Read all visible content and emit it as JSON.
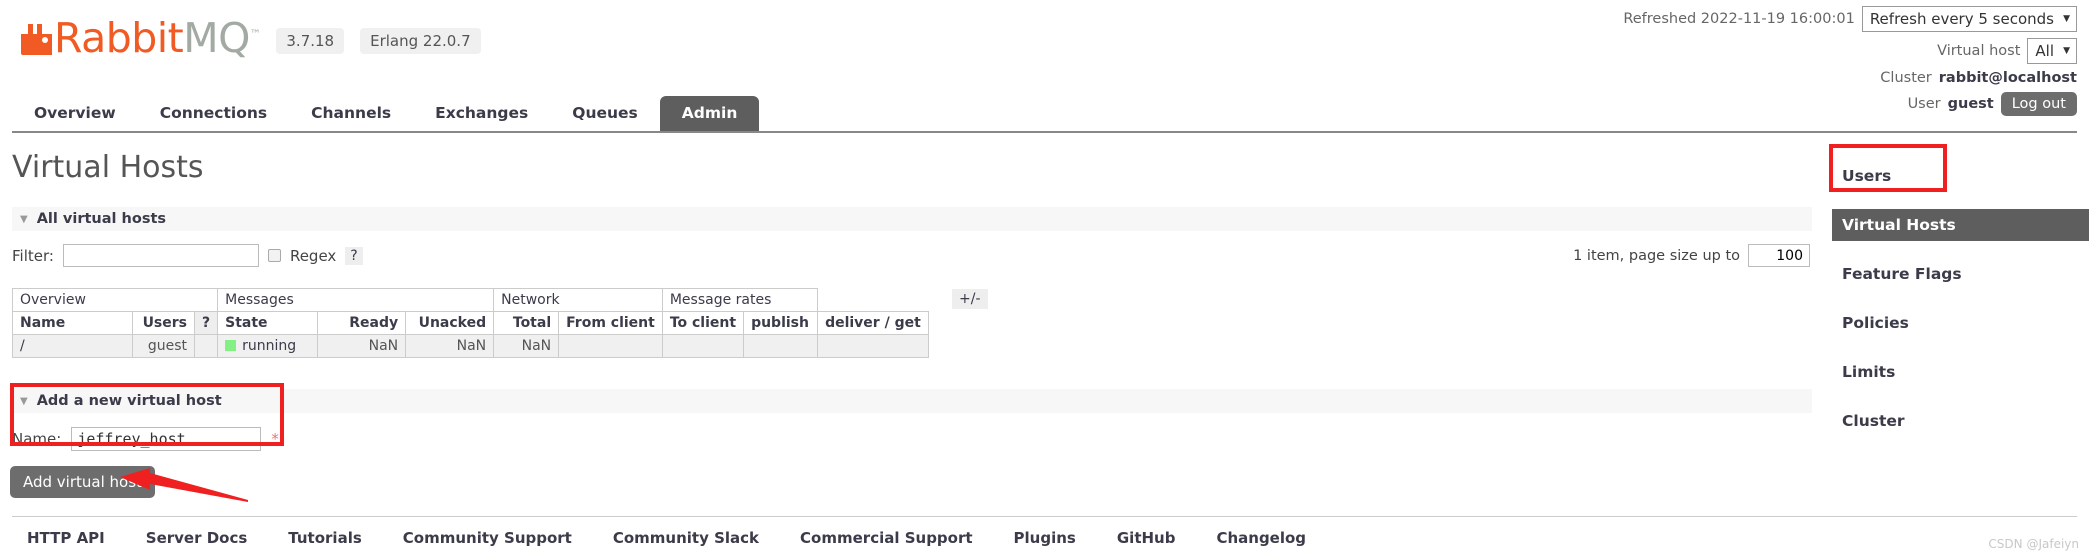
{
  "brand": {
    "name_part1": "Rabbit",
    "name_part2": "MQ",
    "trademark": "™",
    "version": "3.7.18",
    "erlang": "Erlang 22.0.7",
    "accent_color": "#f15a22",
    "muted_color": "#a2aaa3"
  },
  "topbar": {
    "refreshed": "Refreshed 2022-11-19 16:00:01",
    "refresh_interval": "Refresh every 5 seconds",
    "vhost_label": "Virtual host",
    "vhost_value": "All",
    "cluster_label": "Cluster",
    "cluster_value": "rabbit@localhost",
    "user_label": "User",
    "user_value": "guest",
    "logout_label": "Log out"
  },
  "nav": {
    "tabs": [
      {
        "label": "Overview",
        "active": false
      },
      {
        "label": "Connections",
        "active": false
      },
      {
        "label": "Channels",
        "active": false
      },
      {
        "label": "Exchanges",
        "active": false
      },
      {
        "label": "Queues",
        "active": false
      },
      {
        "label": "Admin",
        "active": true
      }
    ]
  },
  "main": {
    "page_title": "Virtual Hosts",
    "list_section_title": "All virtual hosts",
    "filter_label": "Filter:",
    "filter_value": "",
    "filter_placeholder": "",
    "regex_label": "Regex",
    "regex_help": "?",
    "regex_checked": false,
    "pagesize_prefix": "1 item, page size up to",
    "pagesize_value": "100",
    "plusminus": "+/-",
    "table": {
      "group_headers": [
        "Overview",
        "Messages",
        "Network",
        "Message rates"
      ],
      "columns": [
        "Name",
        "Users",
        "?",
        "State",
        "Ready",
        "Unacked",
        "Total",
        "From client",
        "To client",
        "publish",
        "deliver / get"
      ],
      "rows": [
        {
          "name": "/",
          "users": "guest",
          "state": "running",
          "state_color": "#83f083",
          "ready": "NaN",
          "unacked": "NaN",
          "total": "NaN",
          "from_client": "",
          "to_client": "",
          "publish": "",
          "deliver_get": ""
        }
      ]
    },
    "add_section_title": "Add a new virtual host",
    "add_name_label": "Name:",
    "add_name_value": "jeffrey_host",
    "add_required_mark": "*",
    "add_button_label": "Add virtual host"
  },
  "sidebar": {
    "items": [
      {
        "label": "Users",
        "active": false
      },
      {
        "label": "Virtual Hosts",
        "active": true
      },
      {
        "label": "Feature Flags",
        "active": false
      },
      {
        "label": "Policies",
        "active": false
      },
      {
        "label": "Limits",
        "active": false
      },
      {
        "label": "Cluster",
        "active": false
      }
    ]
  },
  "footer": {
    "links": [
      "HTTP API",
      "Server Docs",
      "Tutorials",
      "Community Support",
      "Community Slack",
      "Commercial Support",
      "Plugins",
      "GitHub",
      "Changelog"
    ]
  },
  "watermark": "CSDN @Jafeiyn",
  "annotation_color": "#f02020"
}
